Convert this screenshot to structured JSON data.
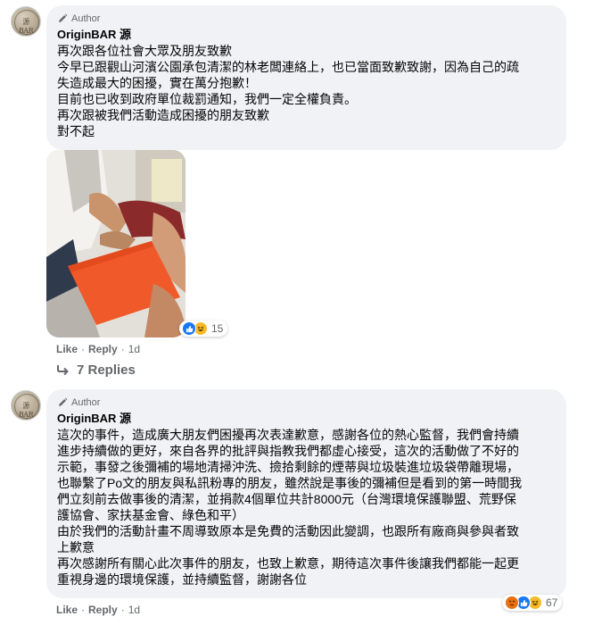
{
  "comments": [
    {
      "badge": "Author",
      "name": "OriginBAR 源",
      "lines": [
        "再次跟各位社會大眾及朋友致歉",
        "今早已跟觀山河濱公園承包清潔的林老闆連絡上，也已當面致歉致謝，因為自己的疏",
        "失造成最大的困擾，實在萬分抱歉！",
        "目前也已收到政府單位裁罰通知，我們一定全權負責。",
        "再次跟被我們活動造成困擾的朋友致歉",
        "對不起"
      ],
      "photo_reactions": {
        "types": [
          "like",
          "haha"
        ],
        "count": "15"
      },
      "actions": {
        "like": "Like",
        "reply": "Reply",
        "time": "1d"
      },
      "replies_label": "7 Replies"
    },
    {
      "badge": "Author",
      "name": "OriginBAR 源",
      "lines": [
        "這次的事件，造成廣大朋友們困擾再次表達歉意，感謝各位的熱心監督，我們會持續",
        "進步持續做的更好，來自各界的批評與指教我們都虛心接受，這次的活動做了不好的",
        "示範，事發之後彌補的場地清掃沖洗、撿拾剩餘的煙蒂與垃圾裝進垃圾袋帶離現場，",
        "也聯繫了Po文的朋友與私訊粉專的朋友，雖然說是事後的彌補但是看到的第一時間我",
        "們立刻前去做事後的清潔，並捐款4個單位共計8000元（台灣環境保護聯盟、荒野保",
        "護協會、家扶基金會、綠色和平）",
        "由於我們的活動計畫不周導致原本是免費的活動因此變調，也跟所有廠商與參與者致",
        "上歉意",
        "再次感謝所有關心此次事件的朋友，也致上歉意，期待這次事件後讓我們都能一起更",
        "重視身邊的環境保護，並持續監督，謝謝各位"
      ],
      "reactions": {
        "types": [
          "angry",
          "like",
          "haha"
        ],
        "count": "67"
      },
      "actions": {
        "like": "Like",
        "reply": "Reply",
        "time": "1d"
      }
    }
  ],
  "colors": {
    "bubble": "#f0f2f5",
    "meta": "#65676b",
    "like": "#1877f2",
    "angry": "#e9710f",
    "haha": "#f7b928"
  },
  "icons": [
    "pencil-icon",
    "reply-arrow-icon",
    "like-reaction-icon",
    "haha-reaction-icon",
    "angry-reaction-icon"
  ]
}
